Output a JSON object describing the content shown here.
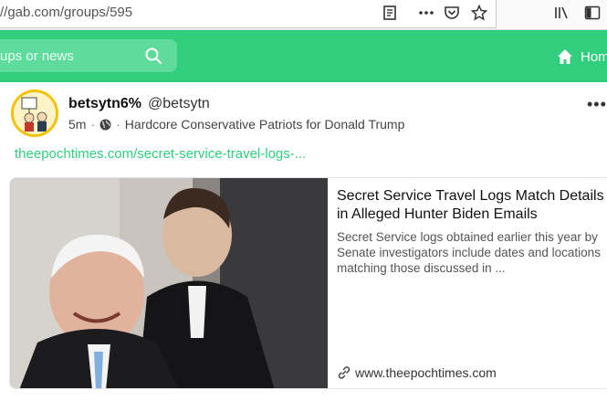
{
  "browser": {
    "url_prefix": "//gab.com/groups/595",
    "icons": [
      "reader-view-icon",
      "page-actions-icon",
      "pocket-icon",
      "bookmark-star-icon",
      "library-icon",
      "sidebar-icon"
    ]
  },
  "header": {
    "search_placeholder": "ups or news",
    "home_label": "Hom"
  },
  "post": {
    "display_name": "betsytn6%",
    "handle": "@betsytn",
    "time": "5m",
    "separator": "·",
    "group": "Hardcore Conservative Patriots for Donald Trump",
    "more_label": "•••",
    "link_text": "theepochtimes.com/secret-service-travel-logs-...",
    "preview": {
      "title": "Secret Service Travel Logs Match Details in Alleged Hunter Biden Emails",
      "description": "Secret Service logs obtained earlier this year by Senate investigators include dates and locations matching those discussed in ...",
      "domain": "www.theepochtimes.com"
    }
  },
  "colors": {
    "accent": "#30ce7d",
    "header_bg": "#30ce7d"
  }
}
